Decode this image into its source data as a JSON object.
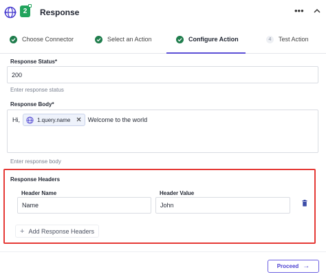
{
  "header": {
    "app_icon": "globe-icon",
    "step_number": "2",
    "title": "Response",
    "menu_icon": "more-icon",
    "collapse_icon": "chevron-up-icon"
  },
  "steps": [
    {
      "label": "Choose Connector",
      "state": "done"
    },
    {
      "label": "Select an Action",
      "state": "done"
    },
    {
      "label": "Configure Action",
      "state": "active"
    },
    {
      "label": "Test Action",
      "number": "4",
      "state": "pending"
    }
  ],
  "form": {
    "response_status": {
      "label": "Response Status*",
      "value": "200",
      "hint": "Enter response status"
    },
    "response_body": {
      "label": "Response Body*",
      "prefix": "Hi,",
      "chip": "1.query.name",
      "suffix": "Welcome to the world",
      "hint": "Enter response body"
    }
  },
  "response_headers": {
    "title": "Response Headers",
    "name_label": "Header Name",
    "value_label": "Header Value",
    "rows": [
      {
        "name": "Name",
        "value": "John"
      }
    ],
    "add_label": "Add Response Headers"
  },
  "footer": {
    "proceed_label": "Proceed"
  },
  "colors": {
    "accent": "#5b4fd6",
    "success": "#1f7d4c",
    "highlight": "#e53935"
  }
}
